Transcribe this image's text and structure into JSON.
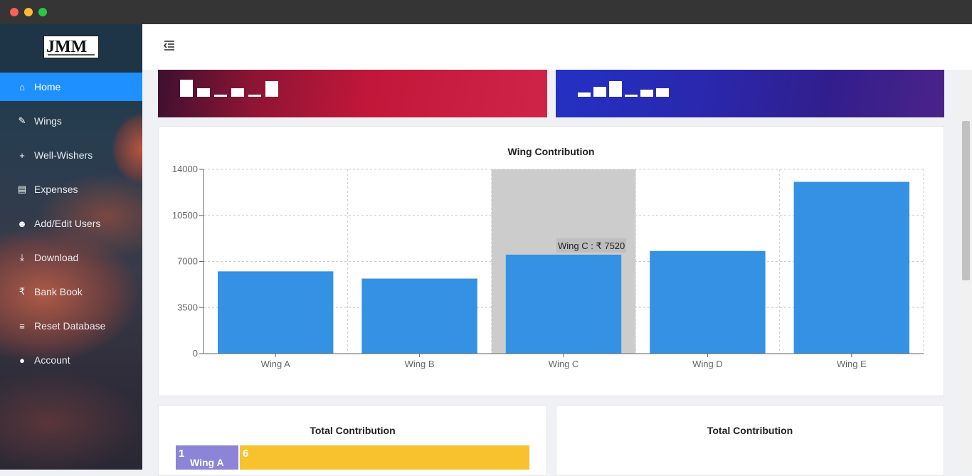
{
  "window": {
    "title": ""
  },
  "sidebar": {
    "logo_text": "JMM",
    "items": [
      {
        "label": "Home",
        "icon": "home-icon",
        "active": true
      },
      {
        "label": "Wings",
        "icon": "edit-icon",
        "active": false
      },
      {
        "label": "Well-Wishers",
        "icon": "plus-icon",
        "active": false
      },
      {
        "label": "Expenses",
        "icon": "file-icon",
        "active": false
      },
      {
        "label": "Add/Edit Users",
        "icon": "users-icon",
        "active": false
      },
      {
        "label": "Download",
        "icon": "download-icon",
        "active": false
      },
      {
        "label": "Bank Book",
        "icon": "rupee-icon",
        "active": false
      },
      {
        "label": "Reset Database",
        "icon": "database-icon",
        "active": false
      },
      {
        "label": "Account",
        "icon": "user-icon",
        "active": false
      }
    ]
  },
  "topbar": {
    "menu_icon": "menu-collapse-icon"
  },
  "colors": {
    "accent": "#1e90ff",
    "bar": "#3591e3",
    "highlight": "#cccccc",
    "treemap_a": "#8b84d7",
    "treemap_b": "#f8c22f"
  },
  "wing_chart": {
    "title": "Wing Contribution",
    "tooltip": "Wing C : ₹ 7520",
    "chart_data": {
      "type": "bar",
      "title": "Wing Contribution",
      "categories": [
        "Wing A",
        "Wing B",
        "Wing C",
        "Wing D",
        "Wing E"
      ],
      "values": [
        6250,
        5700,
        7520,
        7800,
        13050
      ],
      "ylim": [
        0,
        14000
      ],
      "yticks": [
        "0",
        "3500",
        "7000",
        "10500",
        "14000"
      ],
      "grid": true,
      "highlighted_category": "Wing C"
    }
  },
  "total_chart_left": {
    "title": "Total Contribution",
    "cells": [
      {
        "index": "1",
        "label": "Wing A"
      },
      {
        "index": "6",
        "label": ""
      }
    ]
  },
  "total_chart_right": {
    "title": "Total Contribution"
  }
}
